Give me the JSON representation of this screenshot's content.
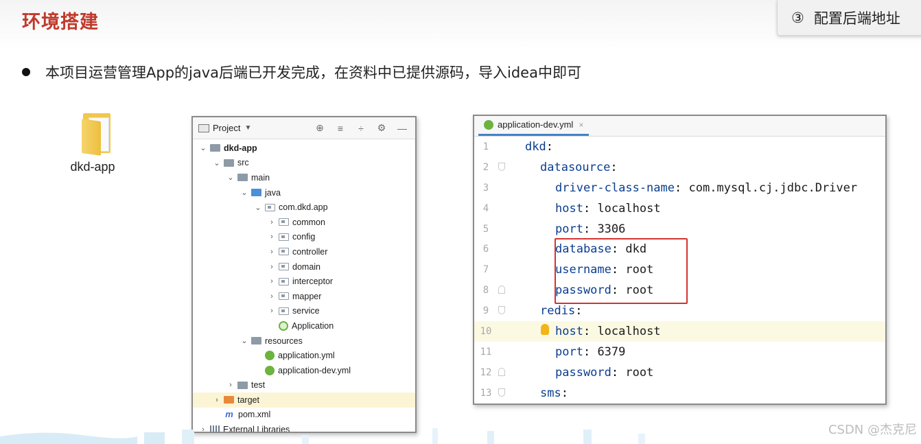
{
  "slide": {
    "title": "环境搭建",
    "step_number": "③",
    "step_label": "配置后端地址",
    "bullet_text": "本项目运营管理App的java后端已开发完成，在资料中已提供源码，导入idea中即可"
  },
  "folder": {
    "label": "dkd-app"
  },
  "project_panel": {
    "toolbar_label": "Project",
    "tree": [
      {
        "label": "dkd-app",
        "depth": 0,
        "arrow": "open",
        "icon": "module",
        "bold": true
      },
      {
        "label": "src",
        "depth": 1,
        "arrow": "open",
        "icon": "folder"
      },
      {
        "label": "main",
        "depth": 2,
        "arrow": "open",
        "icon": "folder"
      },
      {
        "label": "java",
        "depth": 3,
        "arrow": "open",
        "icon": "folder-blue"
      },
      {
        "label": "com.dkd.app",
        "depth": 4,
        "arrow": "open",
        "icon": "package"
      },
      {
        "label": "common",
        "depth": 5,
        "arrow": "closed",
        "icon": "package"
      },
      {
        "label": "config",
        "depth": 5,
        "arrow": "closed",
        "icon": "package"
      },
      {
        "label": "controller",
        "depth": 5,
        "arrow": "closed",
        "icon": "package"
      },
      {
        "label": "domain",
        "depth": 5,
        "arrow": "closed",
        "icon": "package"
      },
      {
        "label": "interceptor",
        "depth": 5,
        "arrow": "closed",
        "icon": "package"
      },
      {
        "label": "mapper",
        "depth": 5,
        "arrow": "closed",
        "icon": "package"
      },
      {
        "label": "service",
        "depth": 5,
        "arrow": "closed",
        "icon": "package"
      },
      {
        "label": "Application",
        "depth": 5,
        "arrow": "none",
        "icon": "spring-class"
      },
      {
        "label": "resources",
        "depth": 3,
        "arrow": "open",
        "icon": "folder-res"
      },
      {
        "label": "application.yml",
        "depth": 4,
        "arrow": "none",
        "icon": "spring"
      },
      {
        "label": "application-dev.yml",
        "depth": 4,
        "arrow": "none",
        "icon": "spring"
      },
      {
        "label": "test",
        "depth": 2,
        "arrow": "closed",
        "icon": "folder"
      },
      {
        "label": "target",
        "depth": 1,
        "arrow": "closed",
        "icon": "folder-orange",
        "highlight": true
      },
      {
        "label": "pom.xml",
        "depth": 1,
        "arrow": "none",
        "icon": "maven"
      },
      {
        "label": "External Libraries",
        "depth": 0,
        "arrow": "closed",
        "icon": "libs"
      }
    ]
  },
  "editor": {
    "tab_label": "application-dev.yml",
    "tab_close": "×",
    "lines": [
      {
        "num": "1",
        "indent": 0,
        "key": "dkd",
        "sep": ":",
        "value": ""
      },
      {
        "num": "2",
        "indent": 1,
        "key": "datasource",
        "sep": ":",
        "value": "",
        "fold": "down"
      },
      {
        "num": "3",
        "indent": 2,
        "key": "driver-class-name",
        "sep": ":",
        "value": " com.mysql.cj.jdbc.Driver"
      },
      {
        "num": "4",
        "indent": 2,
        "key": "host",
        "sep": ":",
        "value": " localhost"
      },
      {
        "num": "5",
        "indent": 2,
        "key": "port",
        "sep": ":",
        "value": " 3306"
      },
      {
        "num": "6",
        "indent": 2,
        "key": "database",
        "sep": ":",
        "value": " dkd"
      },
      {
        "num": "7",
        "indent": 2,
        "key": "username",
        "sep": ":",
        "value": " root"
      },
      {
        "num": "8",
        "indent": 2,
        "key": "password",
        "sep": ":",
        "value": " root",
        "fold": "up"
      },
      {
        "num": "9",
        "indent": 1,
        "key": "redis",
        "sep": ":",
        "value": "",
        "fold": "down"
      },
      {
        "num": "10",
        "indent": 2,
        "key": "host",
        "sep": ":",
        "value": " localhost",
        "current": true,
        "bulb": true
      },
      {
        "num": "11",
        "indent": 2,
        "key": "port",
        "sep": ":",
        "value": " 6379"
      },
      {
        "num": "12",
        "indent": 2,
        "key": "password",
        "sep": ":",
        "value": " root",
        "fold": "up"
      },
      {
        "num": "13",
        "indent": 1,
        "key": "sms",
        "sep": ":",
        "value": "",
        "fold": "down"
      }
    ]
  },
  "watermark": "CSDN @杰克尼",
  "colors": {
    "title_red": "#c0392b",
    "yaml_key": "#0a3d8f",
    "highlight_box": "#d13232",
    "spring_green": "#6db33f"
  }
}
